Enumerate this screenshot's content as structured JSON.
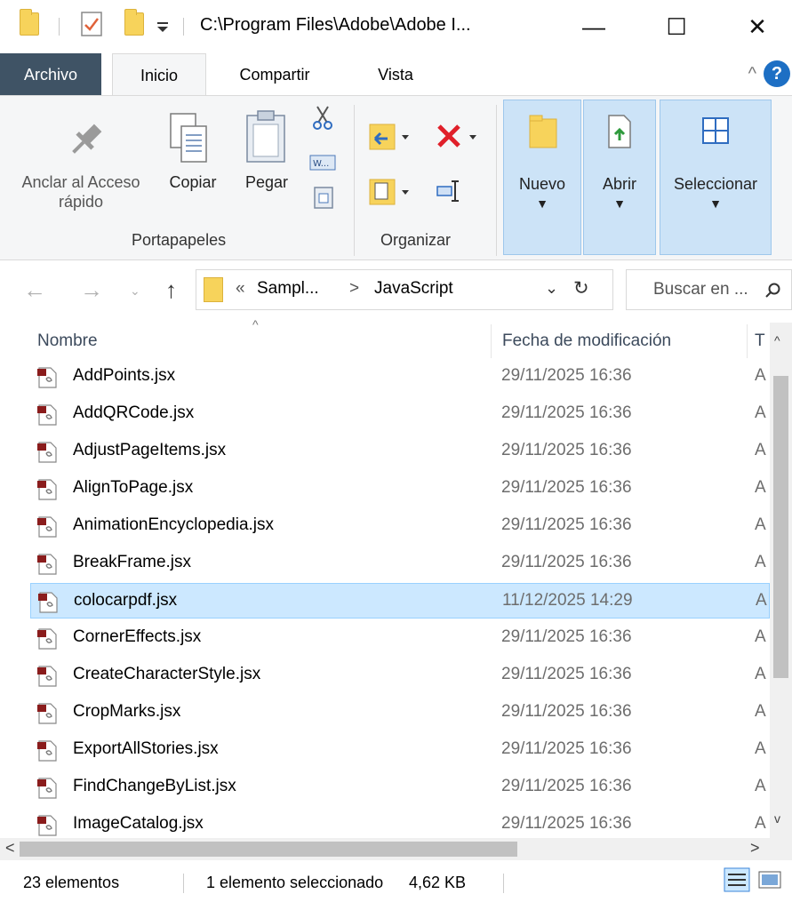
{
  "titlebar": {
    "path": "C:\\Program Files\\Adobe\\Adobe I...",
    "minimize_glyph": "—",
    "maximize_glyph": "☐",
    "close_glyph": "✕"
  },
  "tabs": [
    {
      "label": "Archivo"
    },
    {
      "label": "Inicio"
    },
    {
      "label": "Compartir"
    },
    {
      "label": "Vista"
    }
  ],
  "ribbon": {
    "pin_label": "Anclar al Acceso rápido",
    "copy_label": "Copiar",
    "paste_label": "Pegar",
    "clipboard_group": "Portapapeles",
    "organize_group": "Organizar",
    "new_label": "Nuevo",
    "open_label": "Abrir",
    "select_label": "Seleccionar"
  },
  "address": {
    "crumb_prefix": "«",
    "crumb_parent": "Sampl...",
    "crumb_sep": ">",
    "crumb_current": "JavaScript",
    "search_placeholder": "Buscar en ..."
  },
  "columns": {
    "name": "Nombre",
    "date": "Fecha de modificación",
    "type": "T"
  },
  "files": [
    {
      "name": "AddPoints.jsx",
      "date": "29/11/2025 16:36",
      "type": "A"
    },
    {
      "name": "AddQRCode.jsx",
      "date": "29/11/2025 16:36",
      "type": "A"
    },
    {
      "name": "AdjustPageItems.jsx",
      "date": "29/11/2025 16:36",
      "type": "A"
    },
    {
      "name": "AlignToPage.jsx",
      "date": "29/11/2025 16:36",
      "type": "A"
    },
    {
      "name": "AnimationEncyclopedia.jsx",
      "date": "29/11/2025 16:36",
      "type": "A"
    },
    {
      "name": "BreakFrame.jsx",
      "date": "29/11/2025 16:36",
      "type": "A"
    },
    {
      "name": "colocarpdf.jsx",
      "date": "11/12/2025 14:29",
      "type": "A",
      "selected": true
    },
    {
      "name": "CornerEffects.jsx",
      "date": "29/11/2025 16:36",
      "type": "A"
    },
    {
      "name": "CreateCharacterStyle.jsx",
      "date": "29/11/2025 16:36",
      "type": "A"
    },
    {
      "name": "CropMarks.jsx",
      "date": "29/11/2025 16:36",
      "type": "A"
    },
    {
      "name": "ExportAllStories.jsx",
      "date": "29/11/2025 16:36",
      "type": "A"
    },
    {
      "name": "FindChangeByList.jsx",
      "date": "29/11/2025 16:36",
      "type": "A"
    },
    {
      "name": "ImageCatalog.jsx",
      "date": "29/11/2025 16:36",
      "type": "A"
    }
  ],
  "status": {
    "count": "23 elementos",
    "selection": "1 elemento seleccionado",
    "size": "4,62 KB"
  },
  "colors": {
    "file_tab": "#3f5365",
    "selection_bg": "#cce8ff",
    "selection_border": "#99d1ff",
    "highlight_group": "#cce3f7",
    "folder": "#f7d35b"
  }
}
